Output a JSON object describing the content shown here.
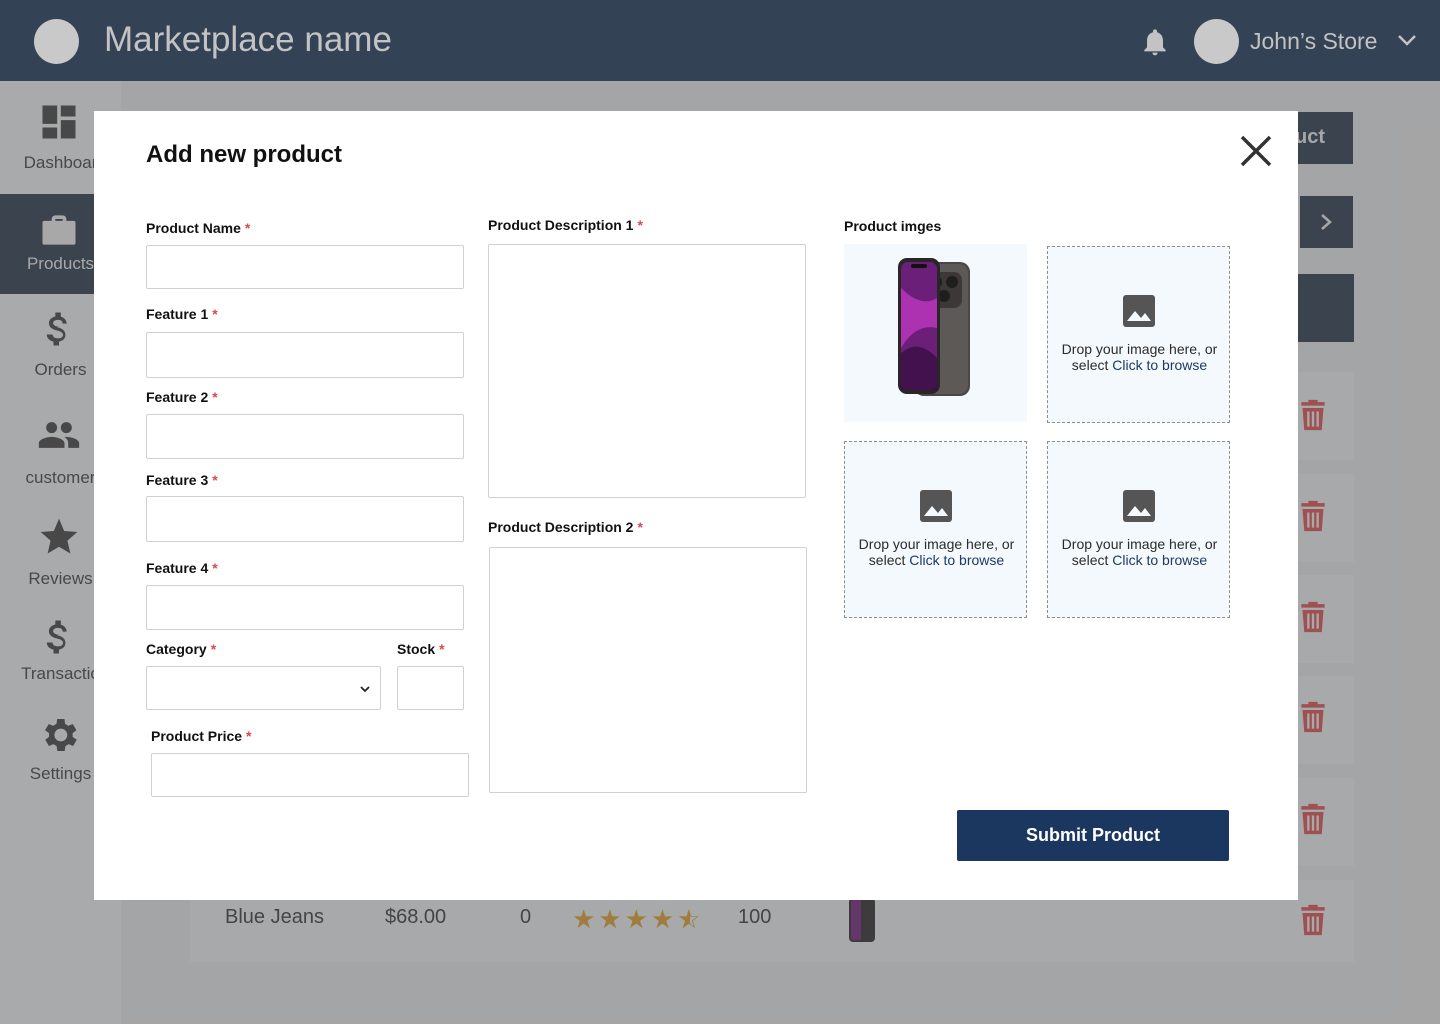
{
  "header": {
    "app_title": "Marketplace name",
    "store_name": "John’s Store"
  },
  "sidebar": {
    "items": [
      {
        "label": "Dashboar",
        "icon": "dashboard-icon"
      },
      {
        "label": "Products",
        "icon": "briefcase-icon",
        "active": true
      },
      {
        "label": "Orders",
        "icon": "dollar-icon"
      },
      {
        "label": "customer",
        "icon": "people-icon"
      },
      {
        "label": "Reviews",
        "icon": "star-icon"
      },
      {
        "label": "Transactio",
        "icon": "dollar-icon"
      },
      {
        "label": "Settings",
        "icon": "gear-icon"
      }
    ]
  },
  "background": {
    "add_button_partial": "uct",
    "last_row": {
      "name": "Blue Jeans",
      "price": "$68.00",
      "orders": "0",
      "rating": 4.5,
      "stock": "100"
    }
  },
  "modal": {
    "title": "Add new product",
    "required_mark": "*",
    "labels": {
      "product_name": "Product Name",
      "feature1": "Feature 1",
      "feature2": "Feature 2",
      "feature3": "Feature 3",
      "feature4": "Feature 4",
      "category": "Category",
      "stock": "Stock",
      "price": "Product Price",
      "desc1": "Product Description 1",
      "desc2": "Product Description 2",
      "images": "Product imges"
    },
    "values": {
      "product_name": "",
      "feature1": "",
      "feature2": "",
      "feature3": "",
      "feature4": "",
      "category": "",
      "stock": "",
      "price": "",
      "desc1": "",
      "desc2": ""
    },
    "dropzone": {
      "text": "Drop your image here, or select ",
      "link": "Click to browse"
    },
    "submit_label": "Submit Product"
  },
  "colors": {
    "header_bg": "#344256",
    "submit_bg": "#1b365f",
    "required": "#d94a4a",
    "trash": "#e05a5a",
    "star": "#e2a63b"
  }
}
